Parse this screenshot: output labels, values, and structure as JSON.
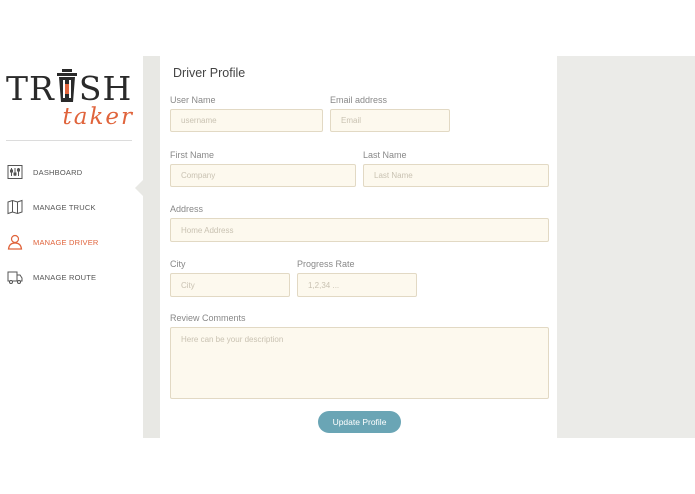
{
  "logo": {
    "top_text_left": "TR",
    "top_text_right": "SH",
    "bottom_text": "taker"
  },
  "sidebar": {
    "items": [
      {
        "label": "DASHBOARD",
        "icon": "dashboard-sliders-icon",
        "active": false
      },
      {
        "label": "MANAGE TRUCK",
        "icon": "map-icon",
        "active": false
      },
      {
        "label": "MANAGE DRIVER",
        "icon": "user-icon",
        "active": true
      },
      {
        "label": "MANAGE ROUTE",
        "icon": "truck-icon",
        "active": false
      }
    ]
  },
  "form": {
    "title": "Driver Profile",
    "username": {
      "label": "User Name",
      "placeholder": "username"
    },
    "email": {
      "label": "Email address",
      "placeholder": "Email"
    },
    "first_name": {
      "label": "First Name",
      "placeholder": "Company"
    },
    "last_name": {
      "label": "Last Name",
      "placeholder": "Last Name"
    },
    "address": {
      "label": "Address",
      "placeholder": "Home Address"
    },
    "city": {
      "label": "City",
      "placeholder": "City"
    },
    "progress_rate": {
      "label": "Progress Rate",
      "placeholder": "1,2,34 ..."
    },
    "review": {
      "label": "Review Comments",
      "placeholder": "Here can be your description"
    },
    "submit_label": "Update Profile"
  },
  "colors": {
    "accent": "#e0643c",
    "button": "#6aa5b5",
    "input_bg": "#fdf9ee",
    "gray_panel": "#ebebe8"
  }
}
